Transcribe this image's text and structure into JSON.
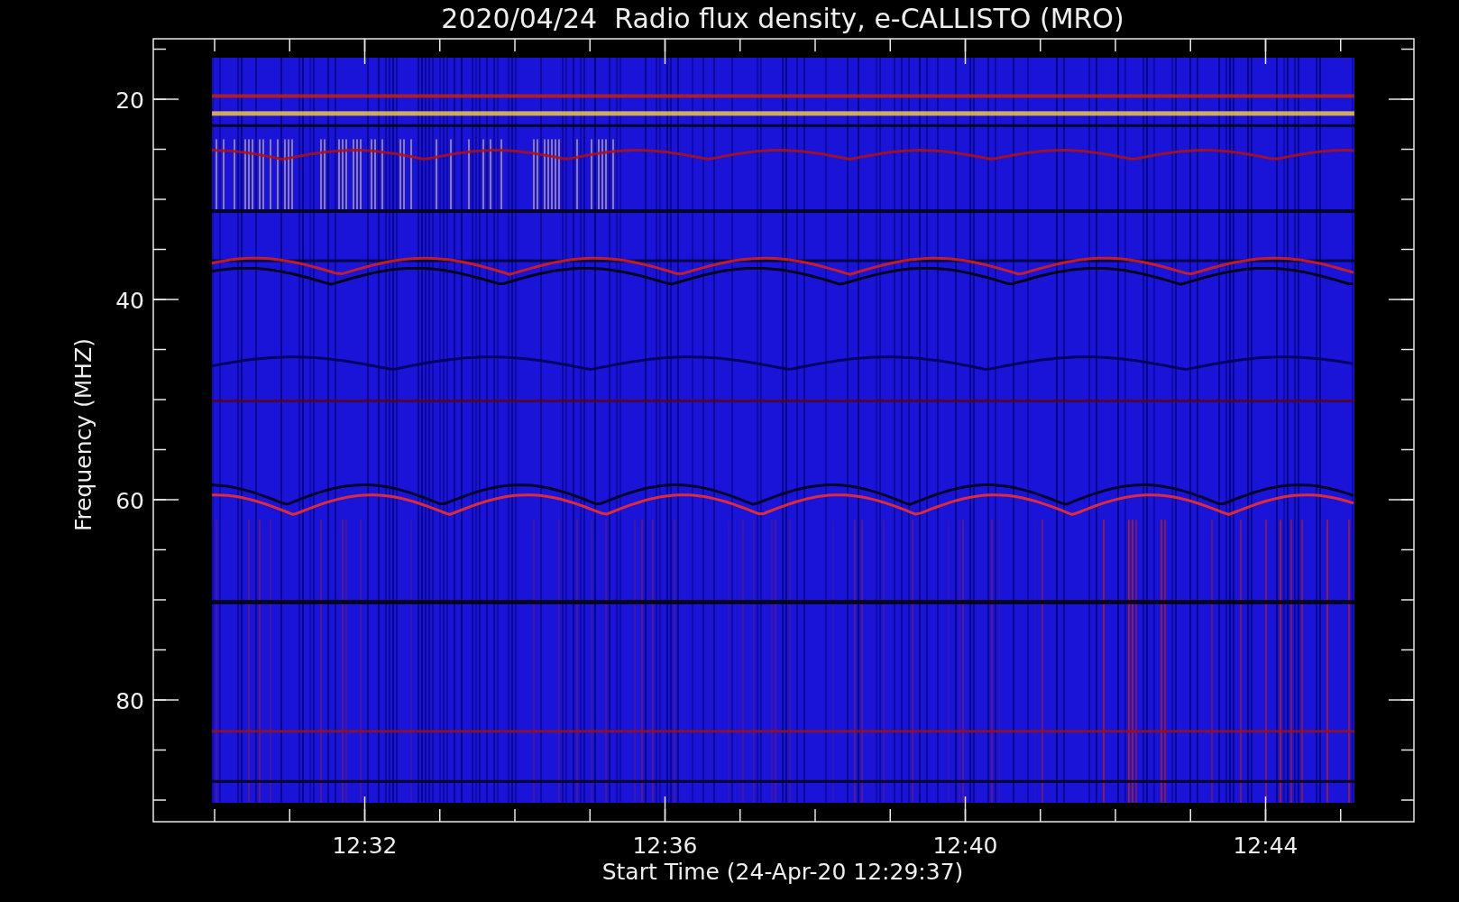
{
  "title": "2020/04/24  Radio flux density, e-CALLISTO (MRO)",
  "y_axis": {
    "label": "Frequency (MHZ)",
    "tick_labels": [
      "20",
      "40",
      "60",
      "80"
    ]
  },
  "x_axis": {
    "label": "Start Time (24-Apr-20 12:29:37)",
    "tick_labels": [
      "12:32",
      "12:36",
      "12:40",
      "12:44"
    ]
  }
}
